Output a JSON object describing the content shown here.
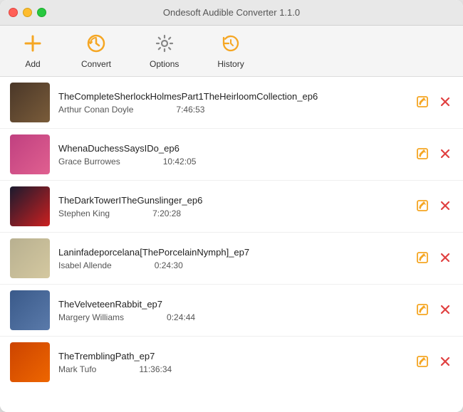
{
  "window": {
    "title": "Ondesoft Audible Converter 1.1.0"
  },
  "toolbar": {
    "add_label": "Add",
    "convert_label": "Convert",
    "options_label": "Options",
    "history_label": "History"
  },
  "books": [
    {
      "id": 1,
      "title": "TheCompleteSherlockHolmesPart1TheHeirloomCollection_ep6",
      "author": "Arthur Conan Doyle",
      "duration": "7:46:53",
      "cover_class": "cover-1"
    },
    {
      "id": 2,
      "title": "WhenaDuchessSaysIDo_ep6",
      "author": "Grace Burrowes",
      "duration": "10:42:05",
      "cover_class": "cover-2"
    },
    {
      "id": 3,
      "title": "TheDarkTowerITheGunslinger_ep6",
      "author": "Stephen King",
      "duration": "7:20:28",
      "cover_class": "cover-3"
    },
    {
      "id": 4,
      "title": "Laninfadeporcelana[ThePorcelainNymph]_ep7",
      "author": "Isabel Allende",
      "duration": "0:24:30",
      "cover_class": "cover-4"
    },
    {
      "id": 5,
      "title": "TheVelveteenRabbit_ep7",
      "author": "Margery Williams",
      "duration": "0:24:44",
      "cover_class": "cover-5"
    },
    {
      "id": 6,
      "title": "TheTremblingPath_ep7",
      "author": "Mark Tufo",
      "duration": "11:36:34",
      "cover_class": "cover-6"
    }
  ]
}
